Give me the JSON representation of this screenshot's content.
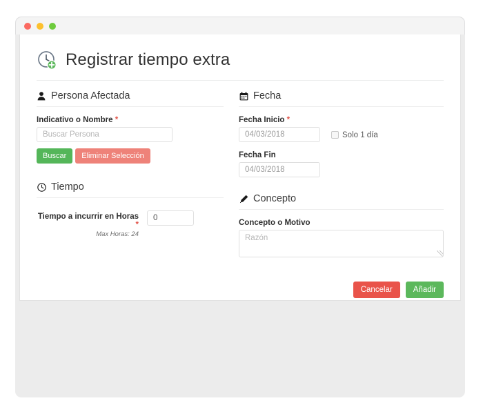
{
  "window": {
    "dots": [
      {
        "name": "close-dot",
        "color": "#fb6a61"
      },
      {
        "name": "minimize-dot",
        "color": "#fcc02e"
      },
      {
        "name": "maximize-dot",
        "color": "#6ecb3d"
      }
    ]
  },
  "page": {
    "title": "Registrar tiempo extra",
    "title_icon": "clock-add-icon"
  },
  "sections": {
    "persona": {
      "icon": "user-icon",
      "heading": "Persona Afectada",
      "name_label": "Indicativo o Nombre",
      "name_required": "*",
      "name_value": "",
      "name_placeholder": "Buscar Persona",
      "search_button": "Buscar",
      "clear_button": "Eliminar Selección"
    },
    "fecha": {
      "icon": "calendar-icon",
      "heading": "Fecha",
      "start_label": "Fecha Inicio",
      "start_required": "*",
      "start_value": "04/03/2018",
      "end_label": "Fecha Fin",
      "end_value": "04/03/2018",
      "single_day_label": "Solo 1 día",
      "single_day_checked": false
    },
    "tiempo": {
      "icon": "clock-icon",
      "heading": "Tiempo",
      "hours_label": "Tiempo a incurrir en Horas",
      "hours_required": "*",
      "hours_hint": "Max Horas: 24",
      "hours_value": "0"
    },
    "concepto": {
      "icon": "pencil-icon",
      "heading": "Concepto",
      "reason_label": "Concepto o Motivo",
      "reason_value": "",
      "reason_placeholder": "Razón"
    }
  },
  "footer": {
    "cancel_label": "Cancelar",
    "submit_label": "Añadir"
  },
  "colors": {
    "green": "#54b659",
    "salmon": "#ee8279",
    "red": "#e9534a",
    "add_green": "#5cb85c",
    "required": "#e2574c",
    "page_bg": "#ececec"
  }
}
